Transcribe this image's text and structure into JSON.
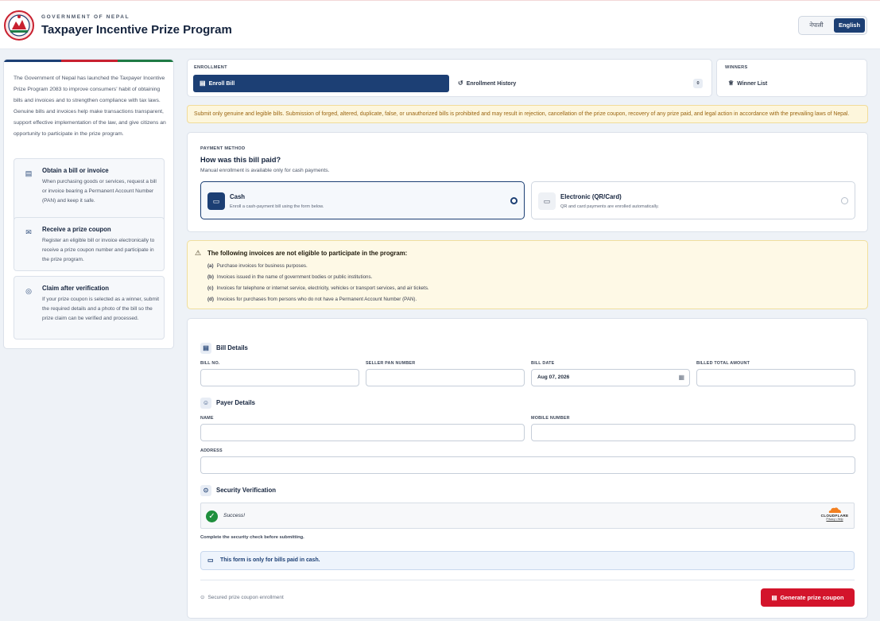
{
  "header": {
    "government": "GOVERNMENT OF NEPAL",
    "title": "Taxpayer Incentive Prize Program",
    "lang_nepali": "नेपाली",
    "lang_english": "English"
  },
  "sidebar": {
    "intro": "The Government of Nepal has launched the Taxpayer Incentive Prize Program 2083 to improve consumers' habit of obtaining bills and invoices and to strengthen compliance with tax laws. Genuine bills and invoices help make transactions transparent, support effective implementation of the law, and give citizens an opportunity to participate in the prize program.",
    "steps": [
      {
        "title": "Obtain a bill or invoice",
        "desc": "When purchasing goods or services, request a bill or invoice bearing a Permanent Account Number (PAN) and keep it safe.",
        "icon": "receipt-icon"
      },
      {
        "title": "Receive a prize coupon",
        "desc": "Register an eligible bill or invoice electronically to receive a prize coupon number and participate in the prize program.",
        "icon": "ticket-icon"
      },
      {
        "title": "Claim after verification",
        "desc": "If your prize coupon is selected as a winner, submit the required details and a photo of the bill so the prize claim can be verified and processed.",
        "icon": "check-circle-icon"
      }
    ]
  },
  "enrollment": {
    "label": "ENROLLMENT",
    "enroll_bill": "Enroll Bill",
    "history": "Enrollment History",
    "history_count": "0"
  },
  "winners": {
    "label": "WINNERS",
    "list": "Winner List"
  },
  "warning": "Submit only genuine and legible bills. Submission of forged, altered, duplicate, false, or unauthorized bills is prohibited and may result in rejection, cancellation of the prize coupon, recovery of any prize paid, and legal action in accordance with the prevailing laws of Nepal.",
  "payment": {
    "label": "PAYMENT METHOD",
    "question": "How was this bill paid?",
    "sub": "Manual enrollment is available only for cash payments.",
    "cash_title": "Cash",
    "cash_desc": "Enroll a cash-payment bill using the form below.",
    "elec_title": "Electronic (QR/Card)",
    "elec_desc": "QR and card payments are enrolled automatically.",
    "selected": "Cash"
  },
  "ineligible": {
    "title": "The following invoices are not eligible to participate in the program:",
    "items": [
      {
        "key": "(a)",
        "text": "Purchase invoices for business purposes."
      },
      {
        "key": "(b)",
        "text": "Invoices issued in the name of government bodies or public institutions."
      },
      {
        "key": "(c)",
        "text": "Invoices for telephone or internet service, electricity, vehicles or transport services, and air tickets."
      },
      {
        "key": "(d)",
        "text": "Invoices for purchases from persons who do not have a Permanent Account Number (PAN)."
      }
    ]
  },
  "form": {
    "bill_details": "Bill Details",
    "bill_no": "BILL NO.",
    "seller_pan": "SELLER PAN NUMBER",
    "bill_date": "BILL DATE",
    "bill_date_value": "Aug 07, 2026",
    "billed_total": "BILLED TOTAL AMOUNT",
    "payer_details": "Payer Details",
    "name": "NAME",
    "mobile": "MOBILE NUMBER",
    "address": "ADDRESS",
    "security": "Security Verification",
    "captcha_status": "Success!",
    "cloudflare": "CLOUDFLARE",
    "cloudflare_links": "Privacy • Help",
    "complete_check": "Complete the security check before submitting.",
    "cash_only": "This form is only for bills paid in cash.",
    "secured": "Secured prize coupon enrollment",
    "generate": "Generate prize coupon"
  },
  "colors": {
    "primary": "#1c3f74",
    "danger": "#d3142b",
    "success": "#1f8f3d",
    "warning_bg": "#fdf6dc",
    "flag_blue": "#1c3f74",
    "flag_red": "#c8202f",
    "flag_green": "#1f7a45"
  }
}
